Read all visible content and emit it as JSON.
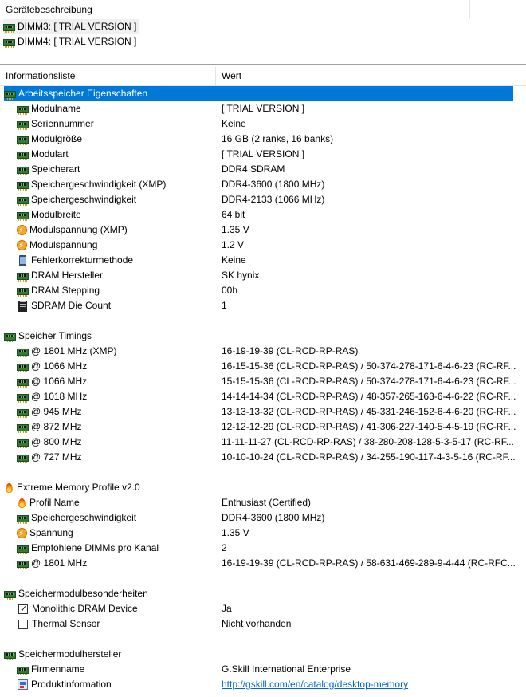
{
  "device_panel": {
    "title": "Gerätebeschreibung",
    "items": [
      {
        "label": "DIMM3: [ TRIAL VERSION ]",
        "selected": true
      },
      {
        "label": "DIMM4: [ TRIAL VERSION ]",
        "selected": false
      }
    ]
  },
  "columns": {
    "name": "Informationsliste",
    "value": "Wert"
  },
  "sections": [
    {
      "title": "Arbeitsspeicher Eigenschaften",
      "icon": "memory-module-icon",
      "selected": true,
      "rows": [
        {
          "name": "Modulname",
          "value": "[ TRIAL VERSION ]",
          "icon": "memory-module-icon"
        },
        {
          "name": "Seriennummer",
          "value": "Keine",
          "icon": "memory-module-icon"
        },
        {
          "name": "Modulgröße",
          "value": "16 GB (2 ranks, 16 banks)",
          "icon": "memory-module-icon"
        },
        {
          "name": "Modulart",
          "value": "[ TRIAL VERSION ]",
          "icon": "memory-module-icon"
        },
        {
          "name": "Speicherart",
          "value": "DDR4 SDRAM",
          "icon": "memory-module-icon"
        },
        {
          "name": "Speichergeschwindigkeit (XMP)",
          "value": "DDR4-3600 (1800 MHz)",
          "icon": "memory-module-icon"
        },
        {
          "name": "Speichergeschwindigkeit",
          "value": "DDR4-2133 (1066 MHz)",
          "icon": "memory-module-icon"
        },
        {
          "name": "Modulbreite",
          "value": "64 bit",
          "icon": "memory-module-icon"
        },
        {
          "name": "Modulspannung (XMP)",
          "value": "1.35 V",
          "icon": "voltage-icon"
        },
        {
          "name": "Modulspannung",
          "value": "1.2 V",
          "icon": "voltage-icon"
        },
        {
          "name": "Fehlerkorrekturmethode",
          "value": "Keine",
          "icon": "ecc-icon"
        },
        {
          "name": "DRAM Hersteller",
          "value": "SK hynix",
          "icon": "memory-module-icon"
        },
        {
          "name": "DRAM Stepping",
          "value": "00h",
          "icon": "memory-module-icon"
        },
        {
          "name": "SDRAM Die Count",
          "value": "1",
          "icon": "die-count-icon"
        }
      ]
    },
    {
      "title": "Speicher Timings",
      "icon": "memory-module-icon",
      "rows": [
        {
          "name": "@ 1801 MHz (XMP)",
          "value": "16-19-19-39  (CL-RCD-RP-RAS)",
          "icon": "memory-module-icon"
        },
        {
          "name": "@ 1066 MHz",
          "value": "16-15-15-36  (CL-RCD-RP-RAS) / 50-374-278-171-6-4-6-23  (RC-RF...",
          "icon": "memory-module-icon"
        },
        {
          "name": "@ 1066 MHz",
          "value": "15-15-15-36  (CL-RCD-RP-RAS) / 50-374-278-171-6-4-6-23  (RC-RF...",
          "icon": "memory-module-icon"
        },
        {
          "name": "@ 1018 MHz",
          "value": "14-14-14-34  (CL-RCD-RP-RAS) / 48-357-265-163-6-4-6-22  (RC-RF...",
          "icon": "memory-module-icon"
        },
        {
          "name": "@ 945 MHz",
          "value": "13-13-13-32  (CL-RCD-RP-RAS) / 45-331-246-152-6-4-6-20  (RC-RF...",
          "icon": "memory-module-icon"
        },
        {
          "name": "@ 872 MHz",
          "value": "12-12-12-29  (CL-RCD-RP-RAS) / 41-306-227-140-5-4-5-19  (RC-RF...",
          "icon": "memory-module-icon"
        },
        {
          "name": "@ 800 MHz",
          "value": "11-11-11-27  (CL-RCD-RP-RAS) / 38-280-208-128-5-3-5-17  (RC-RF...",
          "icon": "memory-module-icon"
        },
        {
          "name": "@ 727 MHz",
          "value": "10-10-10-24  (CL-RCD-RP-RAS) / 34-255-190-117-4-3-5-16  (RC-RF...",
          "icon": "memory-module-icon"
        }
      ]
    },
    {
      "title": "Extreme Memory Profile v2.0",
      "icon": "flame-icon",
      "rows": [
        {
          "name": "Profil Name",
          "value": "Enthusiast (Certified)",
          "icon": "flame-icon"
        },
        {
          "name": "Speichergeschwindigkeit",
          "value": "DDR4-3600 (1800 MHz)",
          "icon": "memory-module-icon"
        },
        {
          "name": "Spannung",
          "value": "1.35 V",
          "icon": "voltage-icon"
        },
        {
          "name": "Empfohlene DIMMs pro Kanal",
          "value": "2",
          "icon": "memory-module-icon"
        },
        {
          "name": "@ 1801 MHz",
          "value": "16-19-19-39  (CL-RCD-RP-RAS) / 58-631-469-289-9-4-44  (RC-RFC...",
          "icon": "memory-module-icon"
        }
      ]
    },
    {
      "title": "Speichermodulbesonderheiten",
      "icon": "memory-module-icon",
      "rows": [
        {
          "name": "Monolithic DRAM Device",
          "value": "Ja",
          "icon": "checkbox-checked-icon"
        },
        {
          "name": "Thermal Sensor",
          "value": "Nicht vorhanden",
          "icon": "checkbox-unchecked-icon"
        }
      ]
    },
    {
      "title": "Speichermodulhersteller",
      "icon": "memory-module-icon",
      "rows": [
        {
          "name": "Firmenname",
          "value": "G.Skill International Enterprise",
          "icon": "memory-module-icon"
        },
        {
          "name": "Produktinformation",
          "value": "http://gskill.com/en/catalog/desktop-memory",
          "icon": "product-info-icon",
          "link": true
        }
      ]
    }
  ],
  "colors": {
    "selection": "#0078d7",
    "link": "#0066cc"
  }
}
